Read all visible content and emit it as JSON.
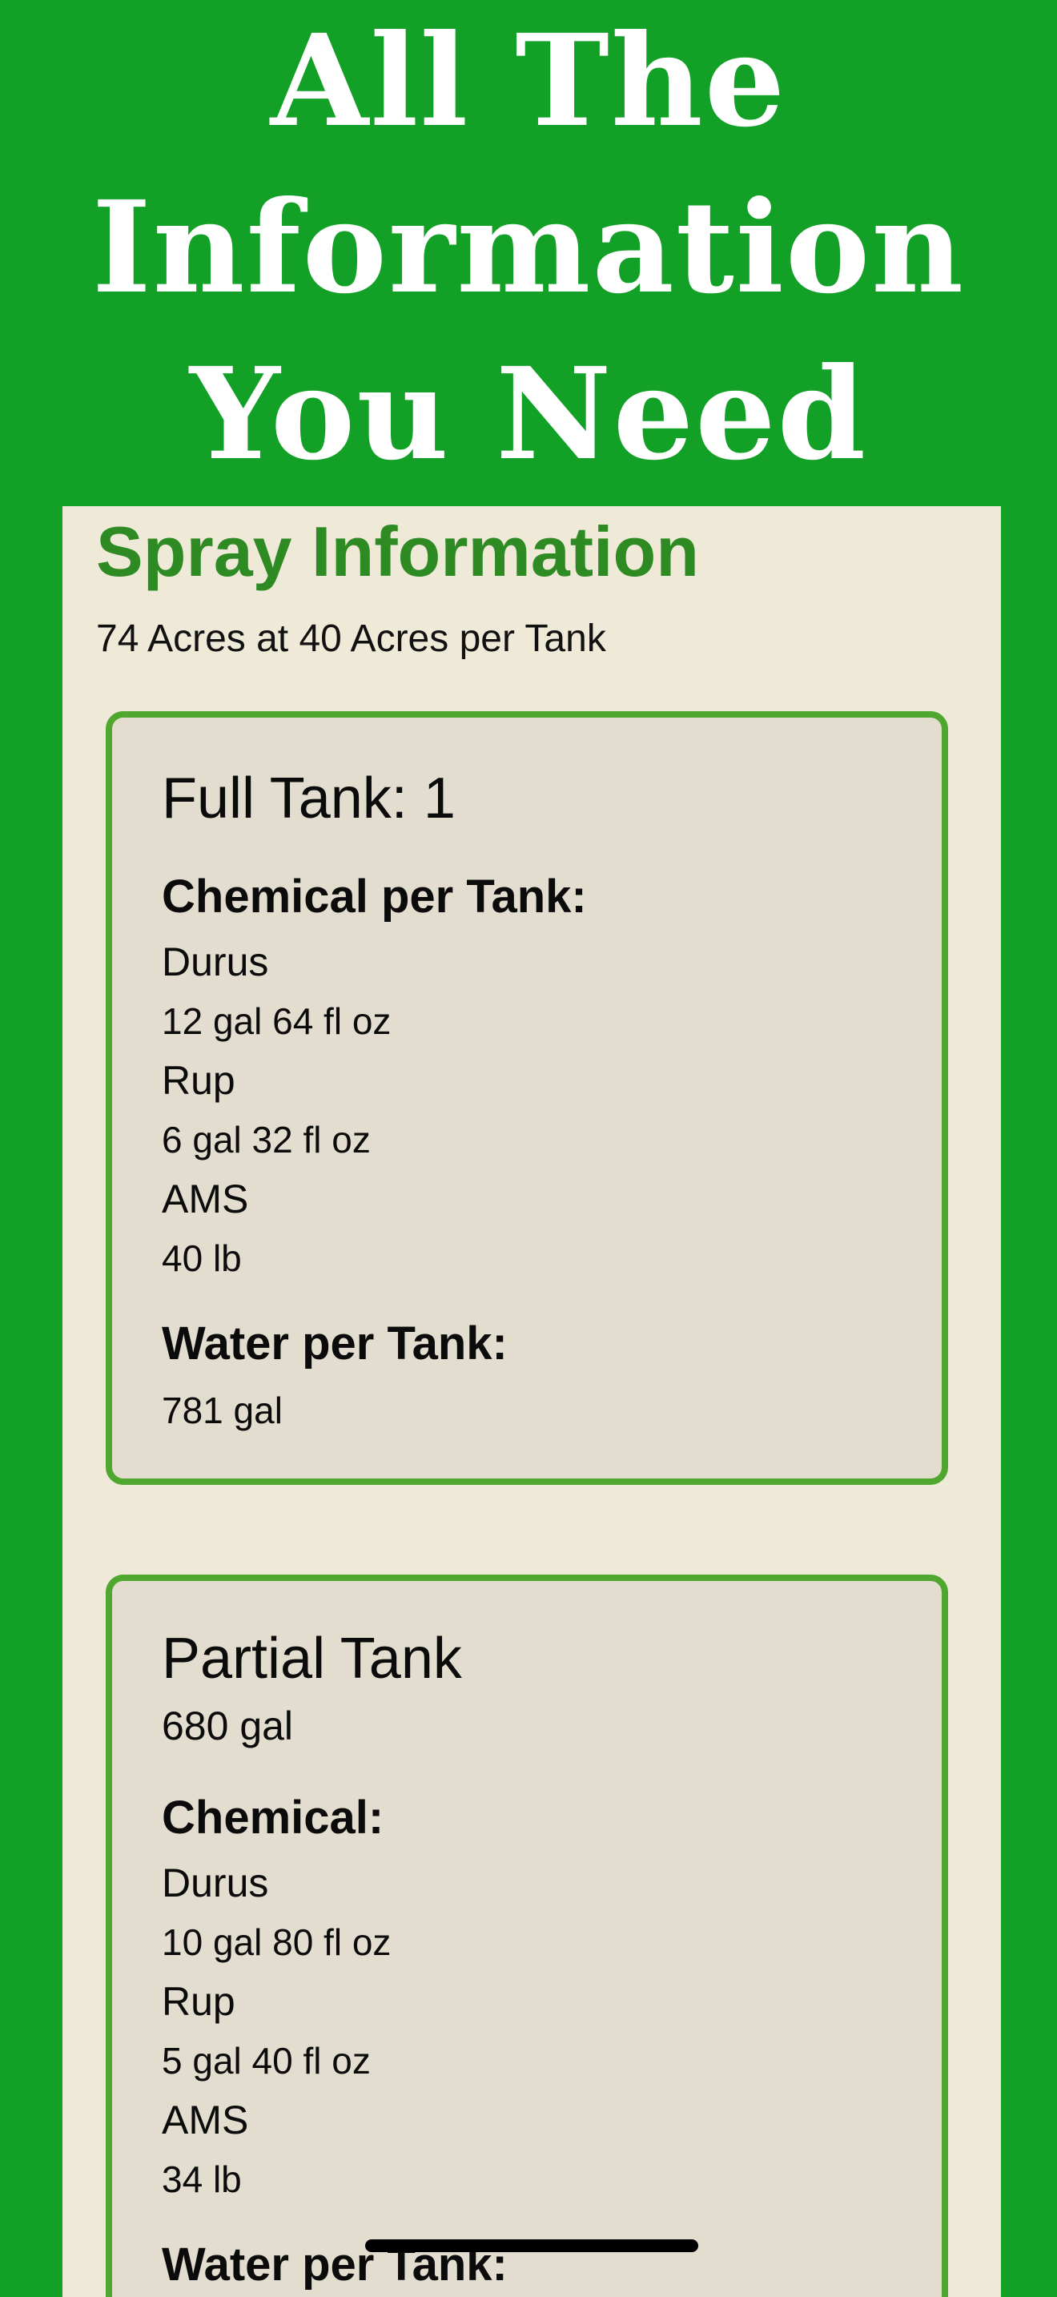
{
  "hero": {
    "lines": [
      "All The",
      "Information",
      "You Need"
    ]
  },
  "panel": {
    "title": "Spray Information",
    "subtitle": "74 Acres at 40 Acres per Tank"
  },
  "full_tank": {
    "title": "Full Tank: 1",
    "chemical_heading": "Chemical per Tank:",
    "chemicals": [
      {
        "name": "Durus",
        "amount": "12 gal 64 fl oz"
      },
      {
        "name": "Rup",
        "amount": "6 gal 32 fl oz"
      },
      {
        "name": "AMS",
        "amount": "40 lb"
      }
    ],
    "water_heading": "Water per Tank:",
    "water_amount": "781 gal"
  },
  "partial_tank": {
    "title": "Partial Tank",
    "volume": "680 gal",
    "chemical_heading": "Chemical:",
    "chemicals": [
      {
        "name": "Durus",
        "amount": "10 gal 80 fl oz"
      },
      {
        "name": "Rup",
        "amount": "5 gal 40 fl oz"
      },
      {
        "name": "AMS",
        "amount": "34 lb"
      }
    ],
    "water_heading": "Water per Tank:"
  }
}
